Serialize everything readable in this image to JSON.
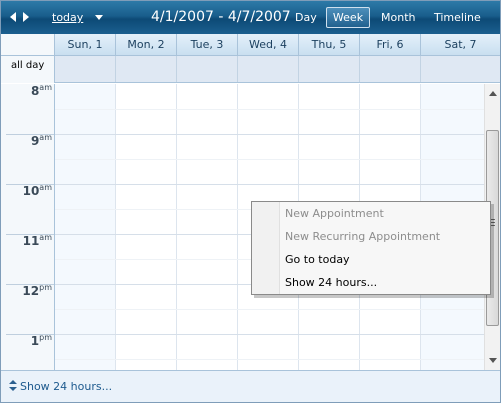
{
  "header": {
    "prev_icon": "chevron-left-icon",
    "next_icon": "chevron-right-icon",
    "today_label": "today",
    "today_dropdown_icon": "caret-down-icon",
    "date_range": "4/1/2007 - 4/7/2007",
    "views": {
      "day": "Day",
      "week": "Week",
      "month": "Month",
      "timeline": "Timeline"
    },
    "active_view": "Week"
  },
  "days": [
    {
      "label": "Sun, 1",
      "weekend": true
    },
    {
      "label": "Mon, 2",
      "weekend": false
    },
    {
      "label": "Tue, 3",
      "weekend": false
    },
    {
      "label": "Wed, 4",
      "weekend": false
    },
    {
      "label": "Thu, 5",
      "weekend": false
    },
    {
      "label": "Fri, 6",
      "weekend": false
    },
    {
      "label": "Sat, 7",
      "weekend": true
    }
  ],
  "all_day_label": "all day",
  "hours": [
    {
      "hour": "8",
      "ampm": "am"
    },
    {
      "hour": "9",
      "ampm": "am"
    },
    {
      "hour": "10",
      "ampm": "am"
    },
    {
      "hour": "11",
      "ampm": "am"
    },
    {
      "hour": "12",
      "ampm": "pm"
    },
    {
      "hour": "1",
      "ampm": "pm"
    }
  ],
  "context_menu": {
    "items": [
      {
        "label": "New Appointment",
        "enabled": false
      },
      {
        "label": "New Recurring Appointment",
        "enabled": false
      },
      {
        "label": "Go to today",
        "enabled": true
      },
      {
        "label": "Show 24 hours...",
        "enabled": true
      }
    ]
  },
  "footer": {
    "icon": "expand-collapse-icon",
    "link": "Show 24 hours..."
  },
  "colors": {
    "header_bg": "#195e8c",
    "weekend_bg": "#f4f9fe",
    "allday_bg": "#dfe8f3",
    "link": "#1d5a8e"
  }
}
